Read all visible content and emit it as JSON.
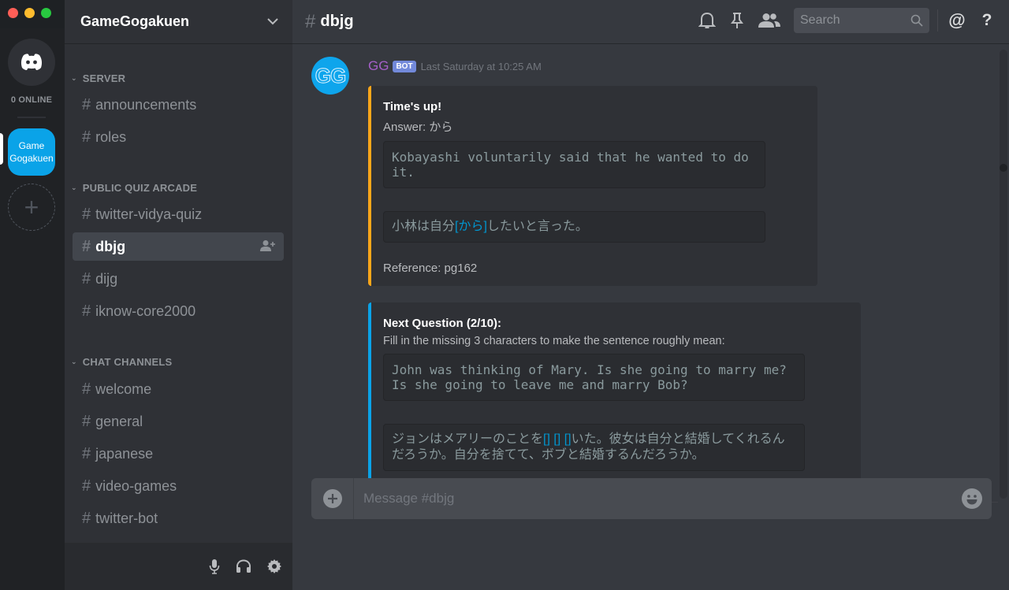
{
  "window": {
    "traffic_lights": [
      "#ff5f57",
      "#febc2e",
      "#28c840"
    ]
  },
  "rail": {
    "home_icon": "discord-logo-icon",
    "online_label": "0 ONLINE",
    "server_label": "Game Gogakuen",
    "server_color": "#0aa3e8",
    "add_server_icon": "plus-icon"
  },
  "guild": {
    "name": "GameGogakuen",
    "categories": [
      {
        "label": "SERVER",
        "channels": [
          "announcements",
          "roles"
        ]
      },
      {
        "label": "PUBLIC QUIZ ARCADE",
        "channels": [
          "twitter-vidya-quiz",
          "dbjg",
          "dijg",
          "iknow-core2000"
        ]
      },
      {
        "label": "CHAT CHANNELS",
        "channels": [
          "welcome",
          "general",
          "japanese",
          "video-games",
          "twitter-bot"
        ]
      }
    ],
    "active_channel": "dbjg"
  },
  "user_bar": {
    "icons": [
      "microphone-icon",
      "headphones-icon",
      "settings-gear-icon"
    ]
  },
  "topbar": {
    "hash": "#",
    "channel_name": "dbjg",
    "search_placeholder": "Search",
    "icons": [
      "bell-icon",
      "pin-icon",
      "members-icon",
      "search-icon",
      "mention-icon",
      "help-icon"
    ]
  },
  "message": {
    "avatar_text": "GG",
    "author": "GG",
    "author_color": "#a55fc9",
    "bot_tag": "BOT",
    "timestamp": "Last Saturday at 10:25 AM",
    "embeds": [
      {
        "color": "#faa61a",
        "title": "Time's up!",
        "description": "Answer: から",
        "english": "Kobayashi voluntarily said that he wanted to do it.",
        "japanese_pre": "小林は自分",
        "japanese_blank": "[から]",
        "japanese_post": "したいと言った。",
        "reference": "Reference: pg162"
      },
      {
        "color": "#0aa3e8",
        "title": "Next Question (2/10):",
        "description": "Fill in the missing 3 characters to make the sentence roughly mean:",
        "english": "John was thinking of Mary. Is she going to marry me? Is she going to leave me and marry Bob?",
        "japanese_pre": "ジョンはメアリーのことを",
        "japanese_blank": "[] [] []",
        "japanese_post": "いた。彼女は自分と結婚してくれるんだろうか。自分を捨てて、ボブと結婚するんだろうか。"
      }
    ]
  },
  "composer": {
    "placeholder": "Message #dbjg",
    "value": ""
  }
}
